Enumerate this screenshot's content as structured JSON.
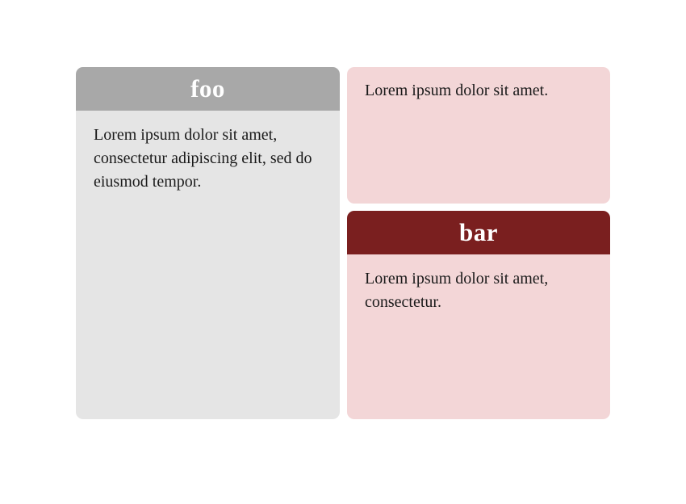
{
  "cards": {
    "foo": {
      "title": "foo",
      "body": "Lorem ipsum dolor sit amet, consectetur adipiscing elit, sed do eiusmod tempor."
    },
    "plain": {
      "body": "Lorem ipsum dolor sit amet."
    },
    "bar": {
      "title": "bar",
      "body": "Lorem ipsum dolor sit amet, consectetur."
    }
  },
  "colors": {
    "foo_header": "#a8a8a8",
    "foo_background": "#e5e5e5",
    "bar_header": "#7a1f1f",
    "bar_background": "#f3d6d7"
  }
}
